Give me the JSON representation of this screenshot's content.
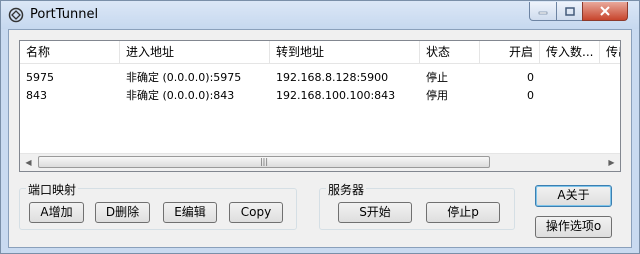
{
  "window": {
    "title": "PortTunnel"
  },
  "table": {
    "columns": [
      "名称",
      "进入地址",
      "转到地址",
      "状态",
      "开启",
      "传入数...",
      "传出"
    ],
    "rows": [
      [
        "5975",
        "非确定 (0.0.0.0):5975",
        "192.168.8.128:5900",
        "停止",
        "0",
        "",
        ""
      ],
      [
        "843",
        "非确定 (0.0.0.0):843",
        "192.168.100.100:843",
        "停用",
        "0",
        "",
        ""
      ]
    ]
  },
  "port_mapping": {
    "legend": "端口映射",
    "add_label": "A增加",
    "delete_label": "D删除",
    "edit_label": "E编辑",
    "copy_label": "Copy"
  },
  "server": {
    "legend": "服务器",
    "start_label": "S开始",
    "stop_label": "停止p"
  },
  "about_label": "A关于",
  "options_label": "操作选项o"
}
